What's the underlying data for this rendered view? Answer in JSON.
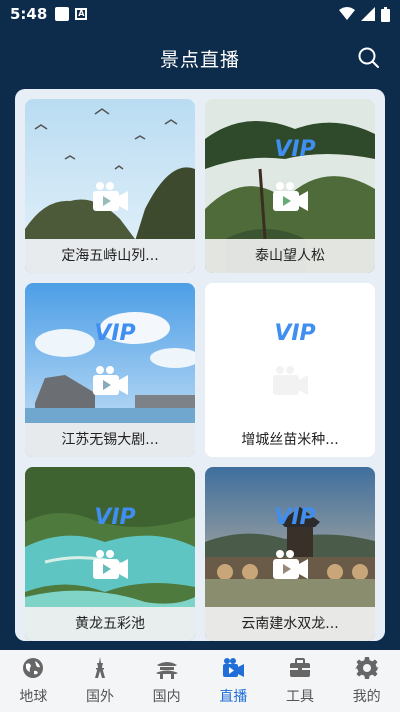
{
  "status_bar": {
    "time": "5:48",
    "notification_letter": "A"
  },
  "header": {
    "title": "景点直播"
  },
  "cards": [
    {
      "label": "定海五峙山列...",
      "vip": false
    },
    {
      "label": "泰山望人松",
      "vip": true
    },
    {
      "label": "江苏无锡大剧...",
      "vip": true
    },
    {
      "label": "增城丝苗米种...",
      "vip": true
    },
    {
      "label": "黄龙五彩池",
      "vip": true
    },
    {
      "label": "云南建水双龙...",
      "vip": true
    }
  ],
  "vip_text": "VIP",
  "tabs": [
    {
      "label": "地球",
      "icon": "globe-icon",
      "active": false
    },
    {
      "label": "国外",
      "icon": "tower-icon",
      "active": false
    },
    {
      "label": "国内",
      "icon": "temple-icon",
      "active": false
    },
    {
      "label": "直播",
      "icon": "video-camera-icon",
      "active": true
    },
    {
      "label": "工具",
      "icon": "toolbox-icon",
      "active": false
    },
    {
      "label": "我的",
      "icon": "gear-icon",
      "active": false
    }
  ],
  "colors": {
    "background": "#0d2b4a",
    "accent": "#1f6fd6",
    "panel": "#e7eef6"
  }
}
